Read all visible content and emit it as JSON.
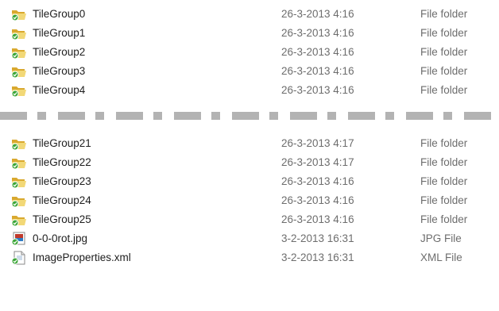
{
  "colors": {
    "folder_light": "#f2d877",
    "folder_dark": "#d9a92f",
    "check_green": "#3aa535",
    "secondary_text": "#6d6d6d",
    "separator": "#b3b3b3"
  },
  "files": [
    {
      "name": "TileGroup0",
      "date": "26-3-2013 4:16",
      "type": "File folder",
      "icon": "folder-icon"
    },
    {
      "name": "TileGroup1",
      "date": "26-3-2013 4:16",
      "type": "File folder",
      "icon": "folder-icon"
    },
    {
      "name": "TileGroup2",
      "date": "26-3-2013 4:16",
      "type": "File folder",
      "icon": "folder-icon"
    },
    {
      "name": "TileGroup3",
      "date": "26-3-2013 4:16",
      "type": "File folder",
      "icon": "folder-icon"
    },
    {
      "name": "TileGroup4",
      "date": "26-3-2013 4:16",
      "type": "File folder",
      "icon": "folder-icon"
    },
    {
      "name": "TileGroup21",
      "date": "26-3-2013 4:17",
      "type": "File folder",
      "icon": "folder-icon"
    },
    {
      "name": "TileGroup22",
      "date": "26-3-2013 4:17",
      "type": "File folder",
      "icon": "folder-icon"
    },
    {
      "name": "TileGroup23",
      "date": "26-3-2013 4:16",
      "type": "File folder",
      "icon": "folder-icon"
    },
    {
      "name": "TileGroup24",
      "date": "26-3-2013 4:16",
      "type": "File folder",
      "icon": "folder-icon"
    },
    {
      "name": "TileGroup25",
      "date": "26-3-2013 4:16",
      "type": "File folder",
      "icon": "folder-icon"
    },
    {
      "name": "0-0-0rot.jpg",
      "date": "3-2-2013 16:31",
      "type": "JPG File",
      "icon": "jpg-file-icon"
    },
    {
      "name": "ImageProperties.xml",
      "date": "3-2-2013 16:31",
      "type": "XML File",
      "icon": "xml-file-icon"
    }
  ]
}
